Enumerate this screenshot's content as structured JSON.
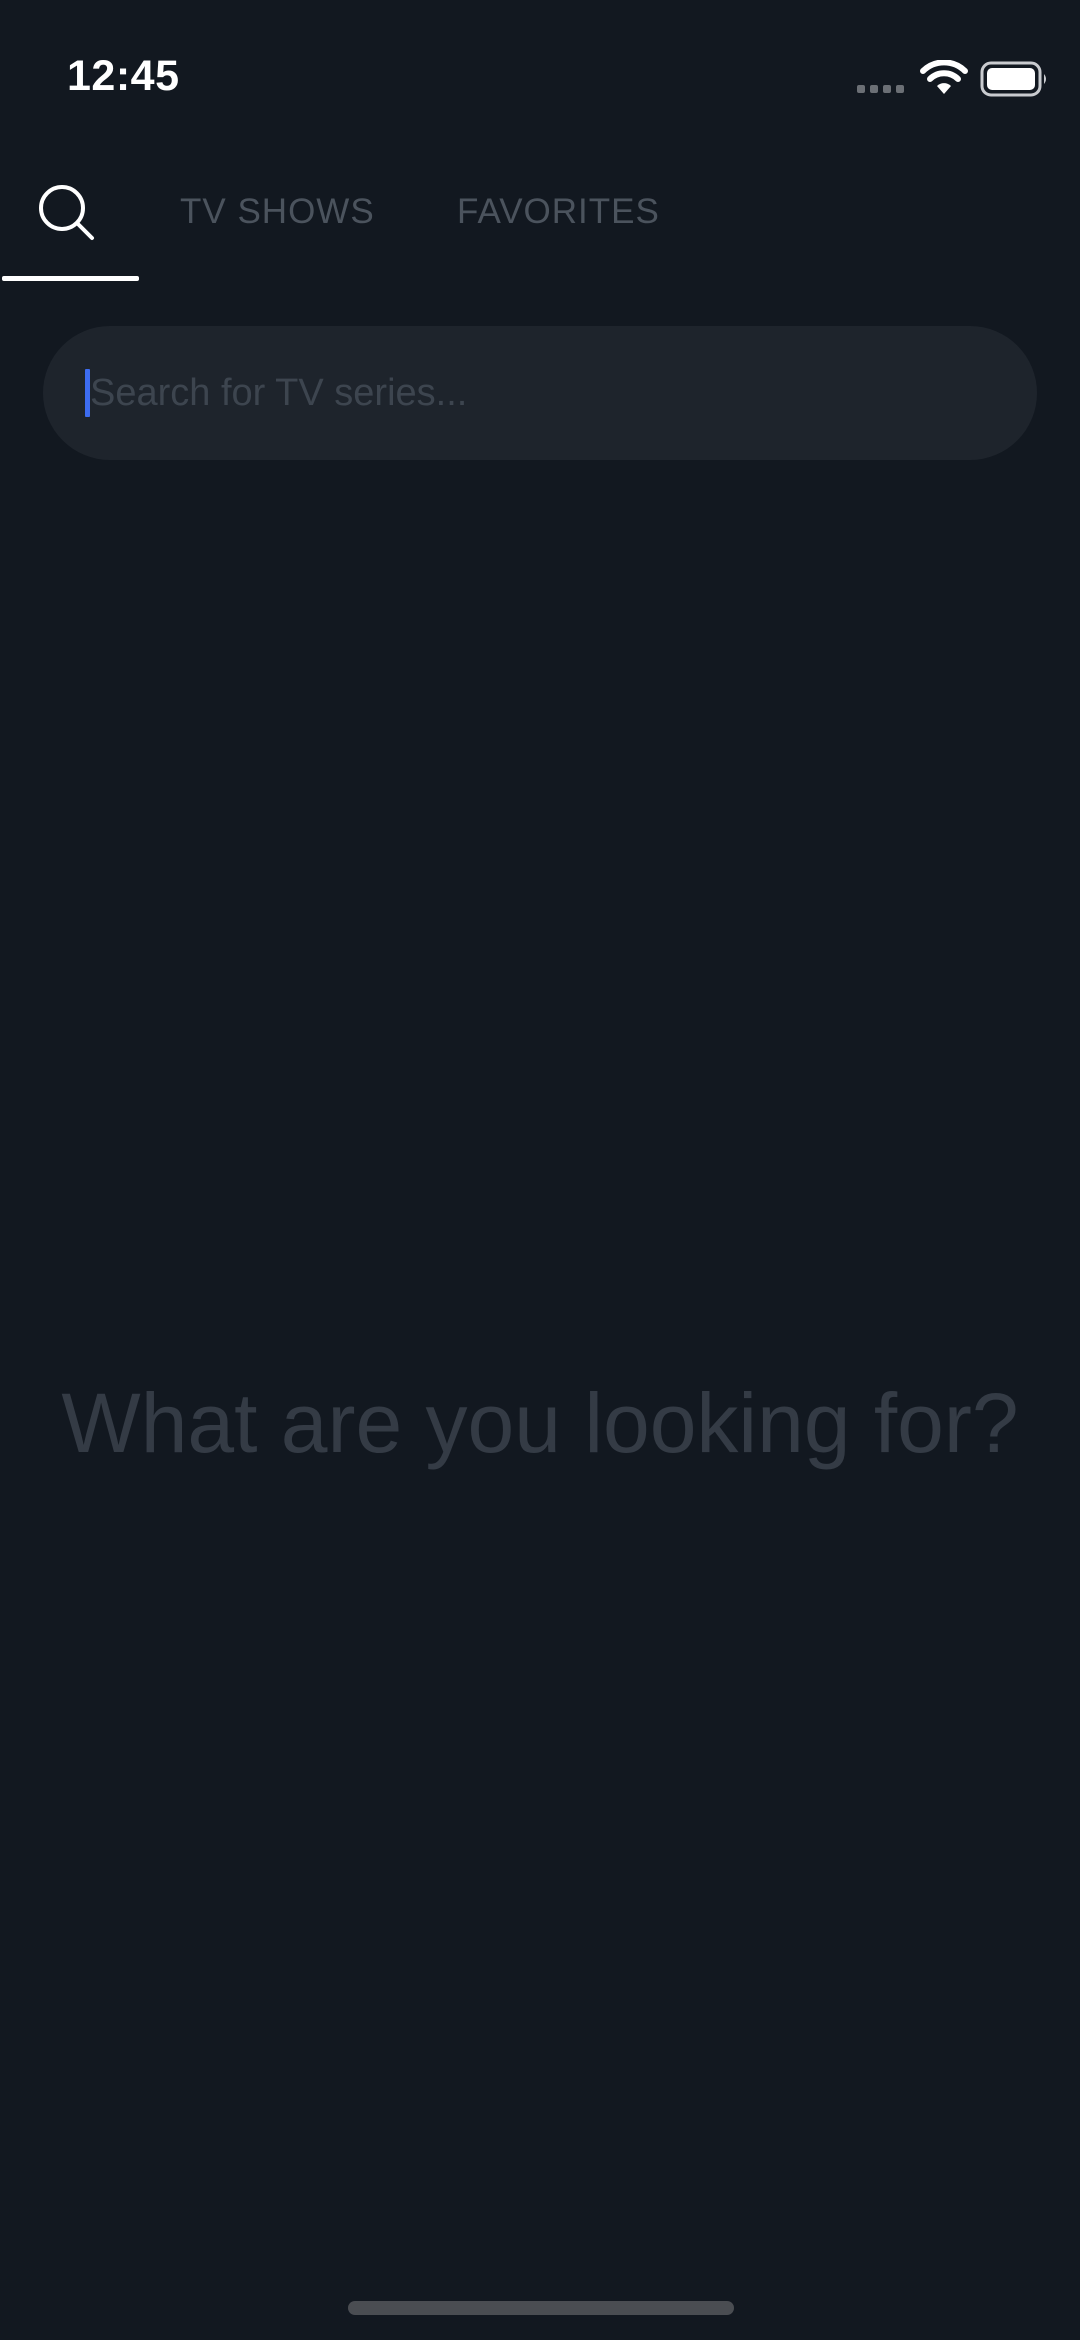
{
  "status_bar": {
    "time": "12:45",
    "icons": [
      "cellular-signal-icon",
      "wifi-icon",
      "battery-icon"
    ]
  },
  "tabs": {
    "search_icon": "search-icon",
    "items": [
      {
        "label": "TV SHOWS"
      },
      {
        "label": "FAVORITES"
      }
    ],
    "active": "search"
  },
  "search": {
    "placeholder": "Search for TV series...",
    "value": ""
  },
  "empty_state": {
    "message": "What are you looking for?"
  },
  "colors": {
    "background": "#121820",
    "search_field": "#1e242c",
    "caret": "#3d6cf0",
    "inactive_tab": "#4b535d",
    "empty_text": "#343b45"
  }
}
